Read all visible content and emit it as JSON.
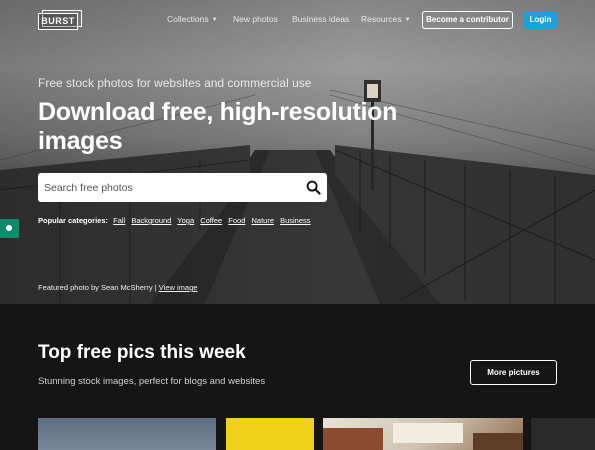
{
  "nav": {
    "logo_text": "BURST",
    "links": [
      {
        "label": "Collections",
        "has_dropdown": true
      },
      {
        "label": "New photos",
        "has_dropdown": false
      },
      {
        "label": "Business ideas",
        "has_dropdown": false
      },
      {
        "label": "Resources",
        "has_dropdown": true
      }
    ],
    "contributor_label": "Become a contributor",
    "login_label": "Login"
  },
  "hero": {
    "tagline": "Free stock photos for websites and commercial use",
    "headline": "Download free, high-resolution images",
    "search_placeholder": "Search free photos",
    "categories_label": "Popular categories:",
    "categories": [
      "Fall",
      "Background",
      "Yoga",
      "Coffee",
      "Food",
      "Nature",
      "Business"
    ],
    "credit_prefix": "Featured photo by Sean McSherry |",
    "credit_link": "View image"
  },
  "section": {
    "title": "Top free pics this week",
    "subtitle": "Stunning stock images, perfect for blogs and websites",
    "more_label": "More pictures"
  },
  "colors": {
    "login_bg": "#1ea0dc",
    "page_bg": "#151515",
    "side_tab": "#0f8a6a"
  },
  "icons": [
    "search-icon",
    "caret-down-icon"
  ]
}
